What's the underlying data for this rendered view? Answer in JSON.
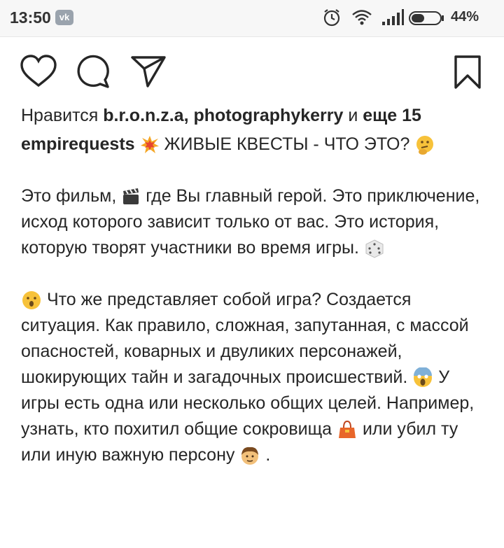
{
  "status_bar": {
    "time": "13:50",
    "app_badge": "vk",
    "battery": "44%",
    "icons": [
      "alarm-icon",
      "wifi-icon",
      "signal-icon",
      "battery-icon"
    ]
  },
  "actions": {
    "icons": [
      "heart-icon",
      "comment-icon",
      "share-icon",
      "bookmark-icon"
    ]
  },
  "likes": {
    "prefix": "Нравится",
    "users": "b.r.o.n.z.a, photographykerry",
    "conj": "и",
    "more": "еще 15"
  },
  "caption": {
    "username": "empirequests",
    "headline": "ЖИВЫЕ КВЕСТЫ - ЧТО ЭТО?",
    "p1a": "Это фильм,",
    "p1b": "где Вы главный герой. Это приключение, исход которого зависит только от вас. Это история, которую творят участники во время игры.",
    "p2a": "Что же представляет собой игра? Создается ситуация. Как правило, сложная, запутанная, с массой опасностей, коварных и двуликих персонажей, шокирующих тайн и загадочных происшествий.",
    "p2b": "У игры есть одна или несколько общих целей. Например, узнать, кто похитил общие сокровища",
    "p2c": "или убил ту или иную важную персону",
    "p2d": "."
  }
}
